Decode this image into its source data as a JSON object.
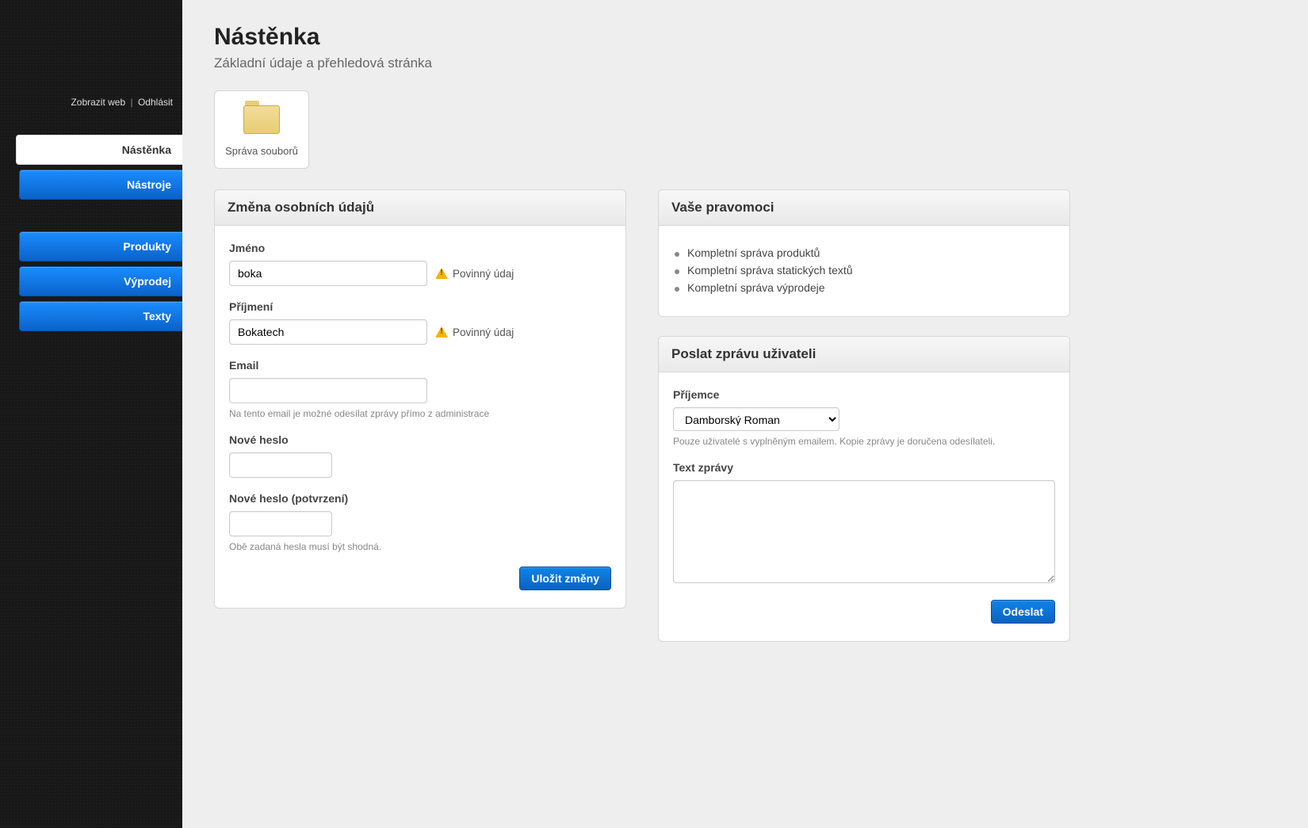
{
  "header": {
    "view_site": "Zobrazit web",
    "logout": "Odhlásit"
  },
  "nav": {
    "group1": [
      {
        "label": "Nástěnka",
        "active": true
      },
      {
        "label": "Nástroje",
        "active": false
      }
    ],
    "group2": [
      {
        "label": "Produkty",
        "active": false
      },
      {
        "label": "Výprodej",
        "active": false
      },
      {
        "label": "Texty",
        "active": false
      }
    ]
  },
  "page": {
    "title": "Nástěnka",
    "subtitle": "Základní údaje a přehledová stránka"
  },
  "tile": {
    "label": "Správa souborů"
  },
  "personal_panel": {
    "title": "Změna osobních údajů",
    "fields": {
      "firstname_label": "Jméno",
      "firstname_value": "boka",
      "lastname_label": "Příjmení",
      "lastname_value": "Bokatech",
      "email_label": "Email",
      "email_value": "",
      "email_hint": "Na tento email je možné odesílat zprávy přímo z administrace",
      "newpass_label": "Nové heslo",
      "newpass_value": "",
      "newpass2_label": "Nové heslo (potvrzení)",
      "newpass2_value": "",
      "pass_hint": "Obě zadaná hesla musí být shodná.",
      "required_text": "Povinný údaj"
    },
    "save_label": "Uložit změny"
  },
  "perms_panel": {
    "title": "Vaše pravomoci",
    "items": [
      "Kompletní správa produktů",
      "Kompletní správa statických textů",
      "Kompletní správa výprodeje"
    ]
  },
  "message_panel": {
    "title": "Poslat zprávu uživateli",
    "recipient_label": "Příjemce",
    "recipient_selected": "Damborský Roman",
    "recipient_hint": "Pouze uživatelé s vyplněným emailem. Kopie zprávy je doručena odesílateli.",
    "body_label": "Text zprávy",
    "body_value": "",
    "send_label": "Odeslat"
  }
}
